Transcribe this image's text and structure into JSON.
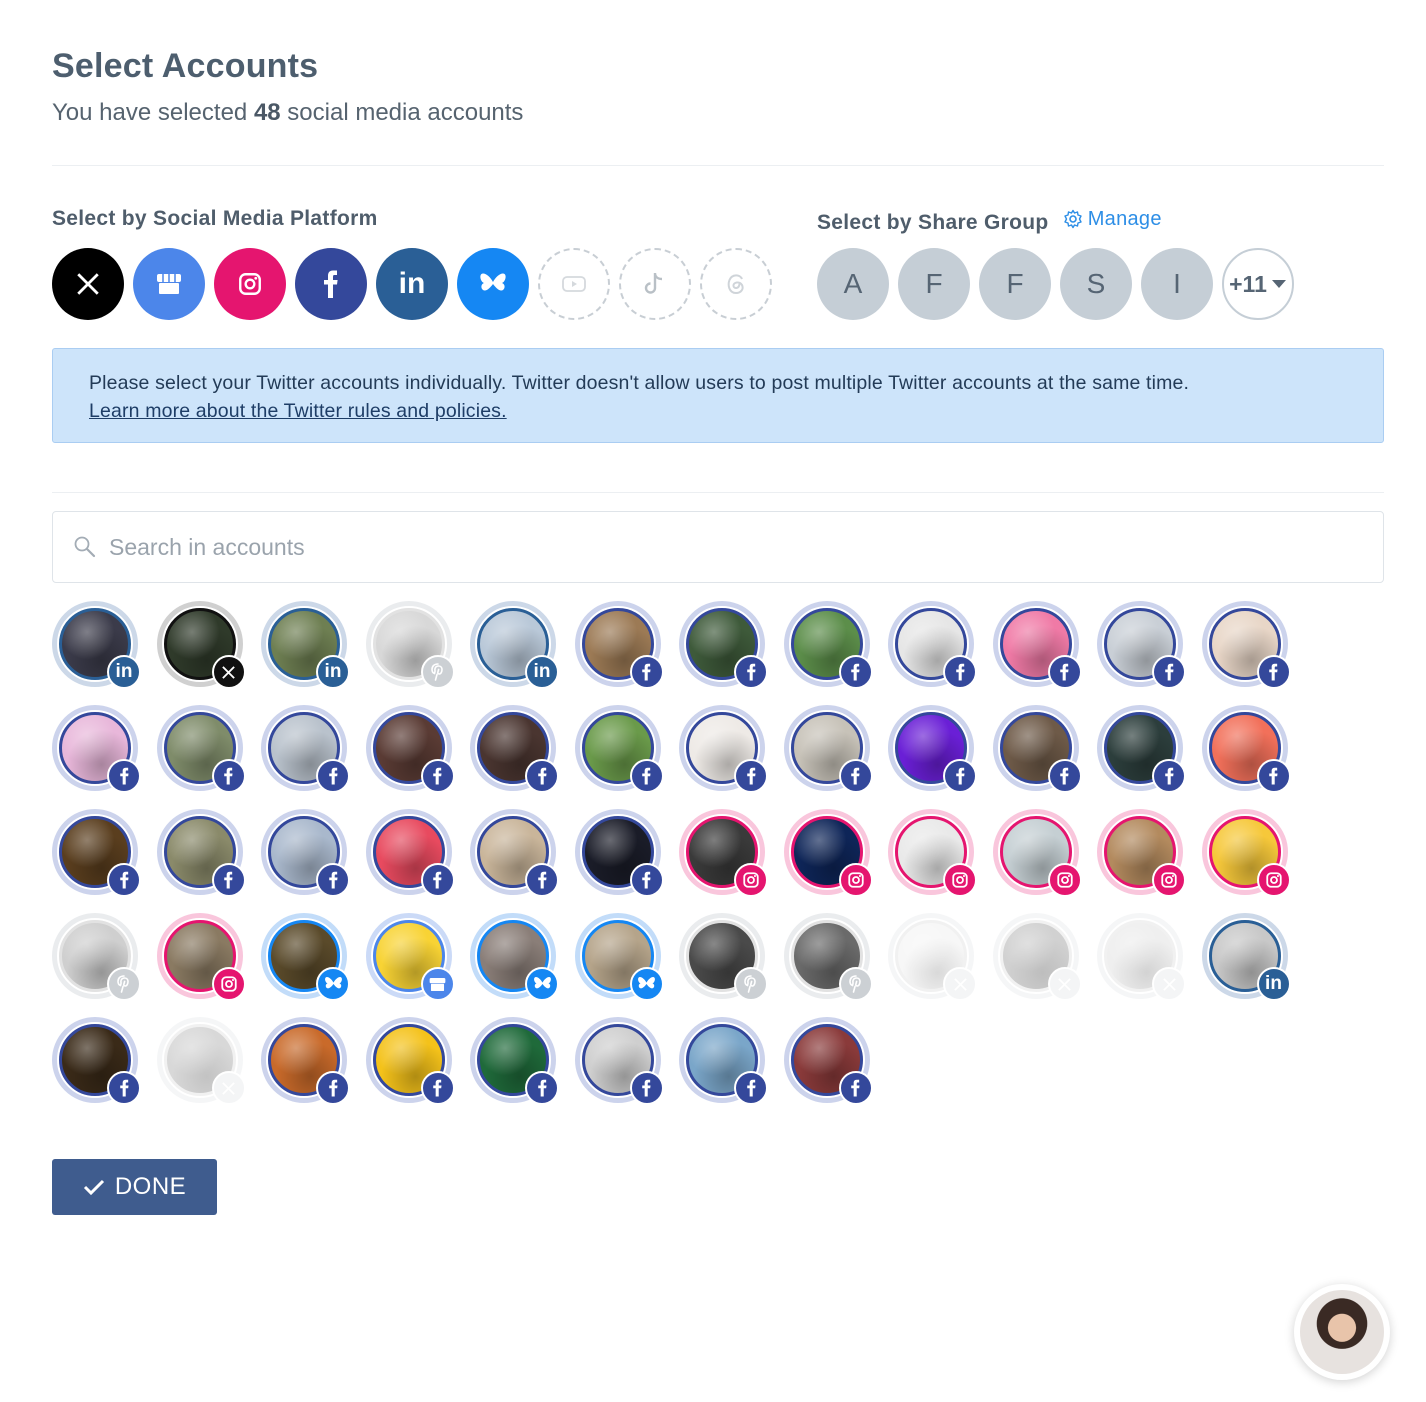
{
  "header": {
    "title": "Select Accounts",
    "subtitle_prefix": "You have selected ",
    "selected_count": "48",
    "subtitle_suffix": " social media accounts"
  },
  "platforms": {
    "heading": "Select by Social Media Platform",
    "items": [
      {
        "name": "x",
        "icon": "x-logo-icon",
        "color": "#000000",
        "enabled": true
      },
      {
        "name": "google-business",
        "icon": "storefront-icon",
        "color": "#4c86ea",
        "enabled": true
      },
      {
        "name": "instagram",
        "icon": "instagram-icon",
        "color": "#e5156f",
        "enabled": true
      },
      {
        "name": "facebook",
        "icon": "facebook-icon",
        "color": "#34489b",
        "enabled": true
      },
      {
        "name": "linkedin",
        "icon": "linkedin-icon",
        "color": "#2a5f96",
        "enabled": true
      },
      {
        "name": "bluesky",
        "icon": "butterfly-icon",
        "color": "#1587f3",
        "enabled": true
      },
      {
        "name": "youtube",
        "icon": "youtube-icon",
        "enabled": false
      },
      {
        "name": "tiktok",
        "icon": "tiktok-icon",
        "enabled": false
      },
      {
        "name": "threads",
        "icon": "threads-icon",
        "enabled": false
      }
    ]
  },
  "share_groups": {
    "heading": "Select by Share Group",
    "manage_label": "Manage",
    "groups": [
      "A",
      "F",
      "F",
      "S",
      "I"
    ],
    "more_label": "+11"
  },
  "alert": {
    "message": "Please select your Twitter accounts individually. Twitter doesn't allow users to post multiple Twitter accounts at the same time.",
    "link_text": "Learn more about the Twitter rules and policies."
  },
  "search": {
    "placeholder": "Search in accounts",
    "value": ""
  },
  "accounts": [
    {
      "platform": "li",
      "avatar_color": "#3b3b4a",
      "disabled": false
    },
    {
      "platform": "x",
      "avatar_color": "#2f3a2a",
      "disabled": false
    },
    {
      "platform": "li",
      "avatar_color": "#6e7f52",
      "disabled": false
    },
    {
      "platform": "pin",
      "avatar_color": "#d8d8d8",
      "disabled": false
    },
    {
      "platform": "li",
      "avatar_color": "#b9c8d8",
      "disabled": false
    },
    {
      "platform": "fb",
      "avatar_color": "#9c7a55",
      "disabled": false
    },
    {
      "platform": "fb",
      "avatar_color": "#3e5a3a",
      "disabled": false
    },
    {
      "platform": "fb",
      "avatar_color": "#5c8e4a",
      "disabled": false
    },
    {
      "platform": "fb",
      "avatar_color": "#e6e6e6",
      "disabled": false
    },
    {
      "platform": "fb",
      "avatar_color": "#f07aa6",
      "disabled": false
    },
    {
      "platform": "fb",
      "avatar_color": "#c9cfd6",
      "disabled": false
    },
    {
      "platform": "fb",
      "avatar_color": "#e8d6c7",
      "disabled": false
    },
    {
      "platform": "fb",
      "avatar_color": "#e8b7da",
      "disabled": false
    },
    {
      "platform": "fb",
      "avatar_color": "#7f8c6a",
      "disabled": false
    },
    {
      "platform": "fb",
      "avatar_color": "#b9c2cc",
      "disabled": false
    },
    {
      "platform": "fb",
      "avatar_color": "#5a3b34",
      "disabled": false
    },
    {
      "platform": "fb",
      "avatar_color": "#4a3530",
      "disabled": false
    },
    {
      "platform": "fb",
      "avatar_color": "#6a9a4a",
      "disabled": false
    },
    {
      "platform": "fb",
      "avatar_color": "#eeeae6",
      "disabled": false
    },
    {
      "platform": "fb",
      "avatar_color": "#c7c2b8",
      "disabled": false
    },
    {
      "platform": "fb",
      "avatar_color": "#6a1fd6",
      "disabled": false
    },
    {
      "platform": "fb",
      "avatar_color": "#6e5a48",
      "disabled": false
    },
    {
      "platform": "fb",
      "avatar_color": "#2c3e3c",
      "disabled": false
    },
    {
      "platform": "fb",
      "avatar_color": "#f2705a",
      "disabled": false
    },
    {
      "platform": "fb",
      "avatar_color": "#5a3e1e",
      "disabled": false
    },
    {
      "platform": "fb",
      "avatar_color": "#8a8a6a",
      "disabled": false
    },
    {
      "platform": "fb",
      "avatar_color": "#a9b8cc",
      "disabled": false
    },
    {
      "platform": "fb",
      "avatar_color": "#e84a5f",
      "disabled": false
    },
    {
      "platform": "fb",
      "avatar_color": "#c9b59a",
      "disabled": false
    },
    {
      "platform": "fb",
      "avatar_color": "#1a1c28",
      "disabled": false
    },
    {
      "platform": "ig",
      "avatar_color": "#3a3a3a",
      "disabled": false
    },
    {
      "platform": "ig",
      "avatar_color": "#0e2558",
      "disabled": false
    },
    {
      "platform": "ig",
      "avatar_color": "#e9e9e9",
      "disabled": false
    },
    {
      "platform": "ig",
      "avatar_color": "#c5cfd3",
      "disabled": false
    },
    {
      "platform": "ig",
      "avatar_color": "#b38a5e",
      "disabled": false
    },
    {
      "platform": "ig",
      "avatar_color": "#f6c83a",
      "disabled": false
    },
    {
      "platform": "pin",
      "avatar_color": "#cfcfcf",
      "disabled": false
    },
    {
      "platform": "ig",
      "avatar_color": "#8a7a62",
      "disabled": false
    },
    {
      "platform": "bs",
      "avatar_color": "#5a4a2a",
      "disabled": false
    },
    {
      "platform": "gb",
      "avatar_color": "#f8d334",
      "disabled": false
    },
    {
      "platform": "bs",
      "avatar_color": "#8a7e78",
      "disabled": false
    },
    {
      "platform": "bs",
      "avatar_color": "#b5a48a",
      "disabled": false
    },
    {
      "platform": "pin",
      "avatar_color": "#4a4a4a",
      "disabled": false
    },
    {
      "platform": "pin",
      "avatar_color": "#6a6a6a",
      "disabled": false
    },
    {
      "platform": "dis",
      "avatar_color": "#eeeeee",
      "disabled": true
    },
    {
      "platform": "dis",
      "avatar_color": "#9a9a9a",
      "disabled": true
    },
    {
      "platform": "dis",
      "avatar_color": "#dcdcdc",
      "disabled": true
    },
    {
      "platform": "li",
      "avatar_color": "#c8c8c8",
      "disabled": false
    },
    {
      "platform": "fb",
      "avatar_color": "#3a2a18",
      "disabled": false
    },
    {
      "platform": "dis",
      "avatar_color": "#aaaaaa",
      "disabled": true
    },
    {
      "platform": "fb",
      "avatar_color": "#c96a2a",
      "disabled": false
    },
    {
      "platform": "fb",
      "avatar_color": "#f4c21a",
      "disabled": false
    },
    {
      "platform": "fb",
      "avatar_color": "#1f6a3a",
      "disabled": false
    },
    {
      "platform": "fb",
      "avatar_color": "#cfcfcf",
      "disabled": false
    },
    {
      "platform": "fb",
      "avatar_color": "#7aa6c9",
      "disabled": false
    },
    {
      "platform": "fb",
      "avatar_color": "#8a3a3a",
      "disabled": false
    }
  ],
  "done_label": "DONE",
  "chat": {
    "avatar_color": "#3a2a24"
  }
}
